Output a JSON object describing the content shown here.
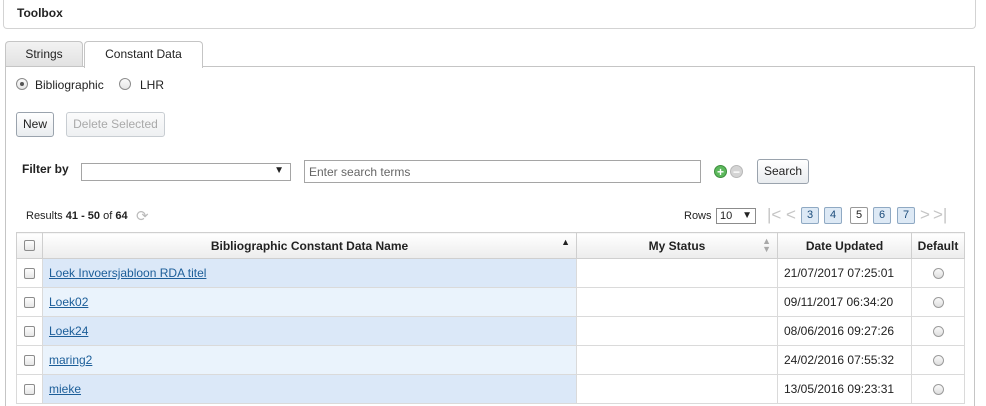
{
  "toolbox": {
    "title": "Toolbox"
  },
  "tabs": [
    {
      "label": "Strings"
    },
    {
      "label": "Constant Data"
    }
  ],
  "radios": [
    {
      "label": "Bibliographic",
      "checked": true
    },
    {
      "label": "LHR",
      "checked": false
    }
  ],
  "buttons": {
    "new": "New",
    "delete_selected": "Delete Selected",
    "search": "Search"
  },
  "filter": {
    "label": "Filter by",
    "selected": "",
    "search_placeholder": "Enter search terms"
  },
  "results": {
    "prefix": "Results",
    "start": "41",
    "separator": "-",
    "end": "50",
    "of": "of",
    "total": "64"
  },
  "pager": {
    "rows_label": "Rows",
    "rows_value": "10",
    "pages": [
      "3",
      "4",
      "5",
      "6",
      "7"
    ],
    "current_page": "5"
  },
  "table": {
    "columns": [
      "Bibliographic Constant Data Name",
      "My Status",
      "Date Updated",
      "Default"
    ],
    "rows": [
      {
        "name": "Loek Invoersjabloon RDA titel",
        "status": "",
        "date": "21/07/2017 07:25:01"
      },
      {
        "name": "Loek02",
        "status": "",
        "date": "09/11/2017 06:34:20"
      },
      {
        "name": "Loek24",
        "status": "",
        "date": "08/06/2016 09:27:26"
      },
      {
        "name": "maring2",
        "status": "",
        "date": "24/02/2016 07:55:32"
      },
      {
        "name": "mieke",
        "status": "",
        "date": "13/05/2016 09:23:31"
      }
    ]
  },
  "icons": [
    "refresh-icon",
    "add-icon",
    "remove-icon",
    "first-page-icon",
    "prev-page-icon",
    "next-page-icon",
    "last-page-icon",
    "sort-asc-icon",
    "sort-both-icon",
    "dropdown-arrow-icon"
  ],
  "colors": {
    "name_column_bg": "#dbe8f8",
    "link": "#1c5e99",
    "add_icon": "#5cb85c",
    "page_button": "#dde9f5"
  }
}
